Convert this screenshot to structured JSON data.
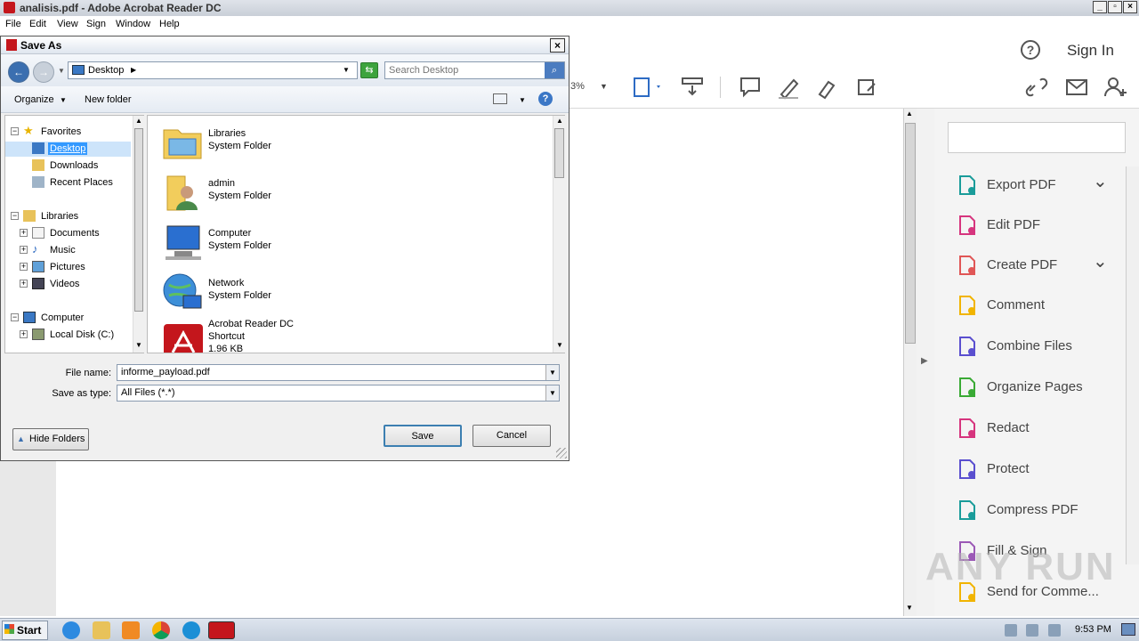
{
  "window": {
    "title": "analisis.pdf - Adobe Acrobat Reader DC"
  },
  "menu": [
    "File",
    "Edit",
    "View",
    "Sign",
    "Window",
    "Help"
  ],
  "toolbar": {
    "zoom_partial": "3%",
    "sign_in": "Sign In",
    "help": "?"
  },
  "right_pane": {
    "tools": [
      {
        "label": "Export PDF",
        "icon": "export-pdf-icon",
        "color": "#1a9c9a",
        "expand": true
      },
      {
        "label": "Edit PDF",
        "icon": "edit-pdf-icon",
        "color": "#d6357e",
        "expand": false
      },
      {
        "label": "Create PDF",
        "icon": "create-pdf-icon",
        "color": "#e05656",
        "expand": true
      },
      {
        "label": "Comment",
        "icon": "comment-icon",
        "color": "#f1b400",
        "expand": false
      },
      {
        "label": "Combine Files",
        "icon": "combine-files-icon",
        "color": "#5a4fcf",
        "expand": false
      },
      {
        "label": "Organize Pages",
        "icon": "organize-pages-icon",
        "color": "#3aaa35",
        "expand": false
      },
      {
        "label": "Redact",
        "icon": "redact-icon",
        "color": "#d6357e",
        "expand": false
      },
      {
        "label": "Protect",
        "icon": "protect-icon",
        "color": "#5a4fcf",
        "expand": false
      },
      {
        "label": "Compress PDF",
        "icon": "compress-pdf-icon",
        "color": "#1a9c9a",
        "expand": false
      },
      {
        "label": "Fill & Sign",
        "icon": "fill-sign-icon",
        "color": "#9b59b6",
        "expand": false
      },
      {
        "label": "Send for Comme...",
        "icon": "send-for-comment-icon",
        "color": "#f1b400",
        "expand": false
      }
    ]
  },
  "watermark": "ANY RUN",
  "dialog": {
    "title": "Save As",
    "address": "Desktop",
    "search_placeholder": "Search Desktop",
    "organize": "Organize",
    "new_folder": "New folder",
    "tree": {
      "favorites": "Favorites",
      "desktop": "Desktop",
      "downloads": "Downloads",
      "recent": "Recent Places",
      "libraries": "Libraries",
      "documents": "Documents",
      "music": "Music",
      "pictures": "Pictures",
      "videos": "Videos",
      "computer": "Computer",
      "local_disk": "Local Disk (C:)"
    },
    "files": [
      {
        "name": "Libraries",
        "type": "System Folder",
        "extra": ""
      },
      {
        "name": "admin",
        "type": "System Folder",
        "extra": ""
      },
      {
        "name": "Computer",
        "type": "System Folder",
        "extra": ""
      },
      {
        "name": "Network",
        "type": "System Folder",
        "extra": ""
      },
      {
        "name": "Acrobat Reader DC",
        "type": "Shortcut",
        "extra": "1.96 KB"
      }
    ],
    "file_name_label": "File name:",
    "file_name_value": "informe_payload.pdf",
    "save_type_label": "Save as type:",
    "save_type_value": "All Files (*.*)",
    "save": "Save",
    "cancel": "Cancel",
    "hide_folders": "Hide Folders"
  },
  "taskbar": {
    "start": "Start",
    "clock": "9:53 PM"
  }
}
